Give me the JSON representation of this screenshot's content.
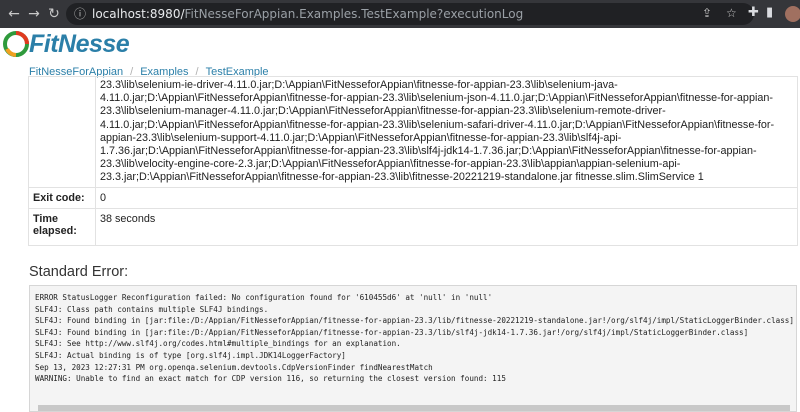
{
  "browser": {
    "url_host": "localhost:8980/",
    "url_rest": "FitNesseForAppian.Examples.TestExample?executionLog"
  },
  "logo": {
    "text": "FitNesse"
  },
  "breadcrumb": [
    "FitNesseForAppian",
    "Examples",
    "TestExample"
  ],
  "execution_log": {
    "command_lines": [
      "23.3\\lib\\selenium-ie-driver-4.11.0.jar;D:\\Appian\\FitNesseforAppian\\fitnesse-for-appian-23.3\\lib\\selenium-java-",
      "4.11.0.jar;D:\\Appian\\FitNesseforAppian\\fitnesse-for-appian-23.3\\lib\\selenium-json-4.11.0.jar;D:\\Appian\\FitNesseforAppian\\fitnesse-for-appian-",
      "23.3\\lib\\selenium-manager-4.11.0.jar;D:\\Appian\\FitNesseforAppian\\fitnesse-for-appian-23.3\\lib\\selenium-remote-driver-",
      "4.11.0.jar;D:\\Appian\\FitNesseforAppian\\fitnesse-for-appian-23.3\\lib\\selenium-safari-driver-4.11.0.jar;D:\\Appian\\FitNesseforAppian\\fitnesse-for-",
      "appian-23.3\\lib\\selenium-support-4.11.0.jar;D:\\Appian\\FitNesseforAppian\\fitnesse-for-appian-23.3\\lib\\slf4j-api-",
      "1.7.36.jar;D:\\Appian\\FitNesseforAppian\\fitnesse-for-appian-23.3\\lib\\slf4j-jdk14-1.7.36.jar;D:\\Appian\\FitNesseforAppian\\fitnesse-for-appian-",
      "23.3\\lib\\velocity-engine-core-2.3.jar;D:\\Appian\\FitNesseforAppian\\fitnesse-for-appian-23.3\\lib\\appian\\appian-selenium-api-",
      "23.3.jar;D:\\Appian\\FitNesseforAppian\\fitnesse-for-appian-23.3\\lib\\fitnesse-20221219-standalone.jar fitnesse.slim.SlimService 1"
    ],
    "exit_code_label": "Exit code:",
    "exit_code": "0",
    "time_label": "Time elapsed:",
    "time_elapsed": "38 seconds"
  },
  "standard_error": {
    "title": "Standard Error:",
    "lines": [
      "ERROR StatusLogger Reconfiguration failed: No configuration found for '610455d6' at 'null' in 'null'",
      "SLF4J: Class path contains multiple SLF4J bindings.",
      "SLF4J: Found binding in [jar:file:/D:/Appian/FitNesseforAppian/fitnesse-for-appian-23.3/lib/fitnesse-20221219-standalone.jar!/org/slf4j/impl/StaticLoggerBinder.class]",
      "SLF4J: Found binding in [jar:file:/D:/Appian/FitNesseforAppian/fitnesse-for-appian-23.3/lib/slf4j-jdk14-1.7.36.jar!/org/slf4j/impl/StaticLoggerBinder.class]",
      "SLF4J: See http://www.slf4j.org/codes.html#multiple_bindings for an explanation.",
      "SLF4J: Actual binding is of type [org.slf4j.impl.JDK14LoggerFactory]",
      "Sep 13, 2023 12:27:31 PM org.openqa.selenium.devtools.CdpVersionFinder findNearestMatch",
      "WARNING: Unable to find an exact match for CDP version 116, so returning the closest version found: 115"
    ]
  }
}
